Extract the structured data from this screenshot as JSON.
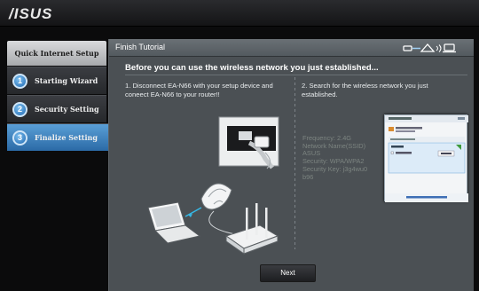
{
  "header": {
    "logo": "/ISUS"
  },
  "sidebar": {
    "title": "Quick Internet Setup",
    "steps": [
      {
        "num": "1",
        "label": "Starting Wizard"
      },
      {
        "num": "2",
        "label": "Security Setting"
      },
      {
        "num": "3",
        "label": "Finalize Setting"
      }
    ]
  },
  "main": {
    "title": "Finish Tutorial",
    "subtitle": "Before you can use the wireless network you just established...",
    "instruction1": "1. Disconnect EA-N66 with your setup device and coneect EA-N66 to your router!!",
    "instruction2": "2. Search for the wireless network you just established.",
    "ssid_info": [
      "Frequency: 2.4G",
      "Network Name(SSID)",
      "ASUS",
      "Security: WPA/WPA2",
      "Security Key: j3g4wu0",
      "b96"
    ],
    "next_label": "Next"
  },
  "icons": {
    "status": "ap-router-client-icon"
  },
  "colors": {
    "accent": "#3676b0",
    "panel": "#4b5054",
    "ssid_text": "#7c8480"
  }
}
